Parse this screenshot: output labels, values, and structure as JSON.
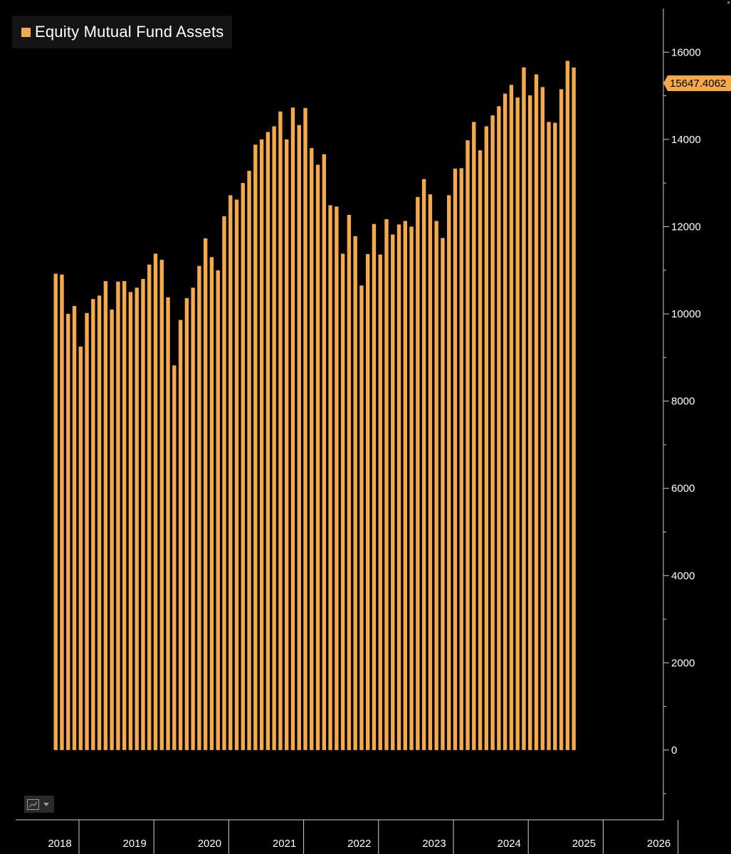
{
  "legend": {
    "label": "Equity Mutual Fund Assets"
  },
  "last_value_label": "15647.4062",
  "colors": {
    "bar": "#f4a94a",
    "background": "#000000",
    "axis": "#cfcfcf",
    "tick_text": "#ffffff"
  },
  "chart_data": {
    "type": "bar",
    "series": [
      {
        "name": "Equity Mutual Fund Assets",
        "values": [
          10920,
          10900,
          10000,
          10180,
          9250,
          10020,
          10340,
          10420,
          10750,
          10100,
          10740,
          10750,
          10500,
          10600,
          10800,
          11130,
          11380,
          11240,
          10380,
          8820,
          9860,
          10360,
          10600,
          11100,
          11730,
          11300,
          11000,
          12240,
          12720,
          12620,
          13000,
          13280,
          13880,
          14000,
          14170,
          14300,
          14640,
          14000,
          14730,
          14330,
          14720,
          13800,
          13420,
          13660,
          12490,
          12460,
          11380,
          12270,
          11780,
          10650,
          11370,
          12060,
          11360,
          12170,
          11820,
          12050,
          12130,
          12000,
          12680,
          13090,
          12740,
          12130,
          11740,
          12720,
          13330,
          13340,
          13980,
          14400,
          13750,
          14300,
          14550,
          14760,
          15050,
          15250,
          14960,
          15650,
          15010,
          15490,
          15200,
          14400,
          14380,
          15150,
          15800,
          15647.4062
        ]
      }
    ],
    "start_date": "2018-01",
    "frequency": "monthly",
    "xlabel": "",
    "ylabel": "",
    "ylim": [
      -1600,
      17000
    ],
    "y_ticks": [
      "0",
      "2000",
      "4000",
      "6000",
      "8000",
      "10000",
      "12000",
      "14000",
      "16000"
    ],
    "x_ticks": [
      "2018",
      "2019",
      "2020",
      "2021",
      "2022",
      "2023",
      "2024",
      "2025",
      "2026"
    ],
    "grid": false,
    "legend_position": "top-left"
  }
}
